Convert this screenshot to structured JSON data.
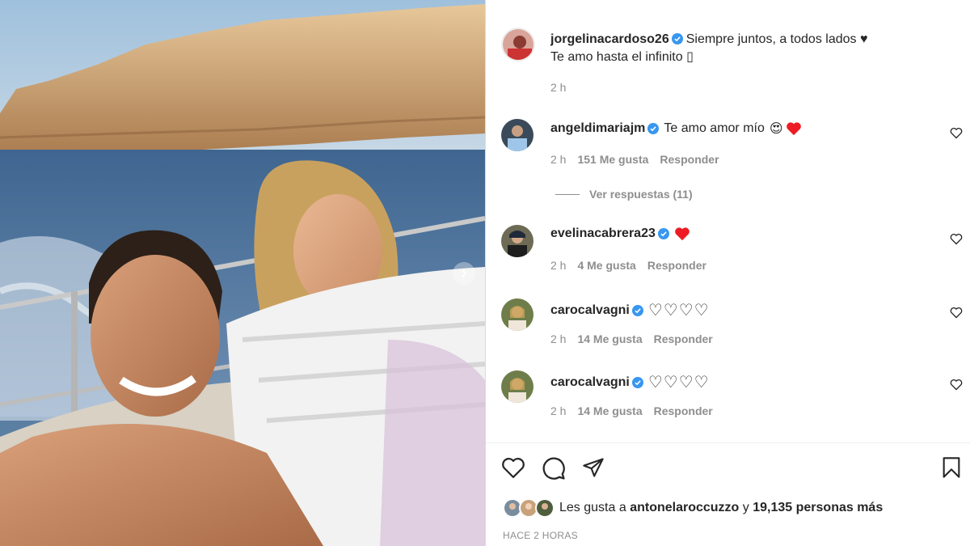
{
  "post": {
    "author": "jorgelinacardoso26",
    "caption_line1": "Siempre juntos, a todos lados ♥",
    "caption_line2": "Te amo hasta el infinito ▯",
    "time": "2 h"
  },
  "comments": [
    {
      "username": "angeldimariajm",
      "text": "Te amo amor mío",
      "emojis": [
        "😍",
        "❤️"
      ],
      "time": "2 h",
      "likes": "151 Me gusta",
      "reply": "Responder"
    },
    {
      "username": "evelinacabrera23",
      "text": "",
      "emojis": [
        "❤️"
      ],
      "time": "2 h",
      "likes": "4 Me gusta",
      "reply": "Responder"
    },
    {
      "username": "carocalvagni",
      "text": "",
      "emojis": [
        "♡♡♡♡"
      ],
      "time": "2 h",
      "likes": "14 Me gusta",
      "reply": "Responder"
    },
    {
      "username": "carocalvagni",
      "text": "",
      "emojis": [
        "♡♡♡♡"
      ],
      "time": "2 h",
      "likes": "14 Me gusta",
      "reply": "Responder"
    }
  ],
  "view_replies": "Ver respuestas (11)",
  "actions": {
    "like_icon": "heart-outline-icon",
    "comment_icon": "comment-bubble-icon",
    "share_icon": "paper-plane-icon",
    "save_icon": "bookmark-icon"
  },
  "likes": {
    "prefix": "Les gusta a",
    "user": "antonelaroccuzzo",
    "connector": "y",
    "count": "19,135 personas más"
  },
  "time_ago": "HACE 2 HORAS",
  "colors": {
    "verified": "#3897f0",
    "red_heart": "#ed1c24",
    "muted": "#8e8e8e"
  }
}
